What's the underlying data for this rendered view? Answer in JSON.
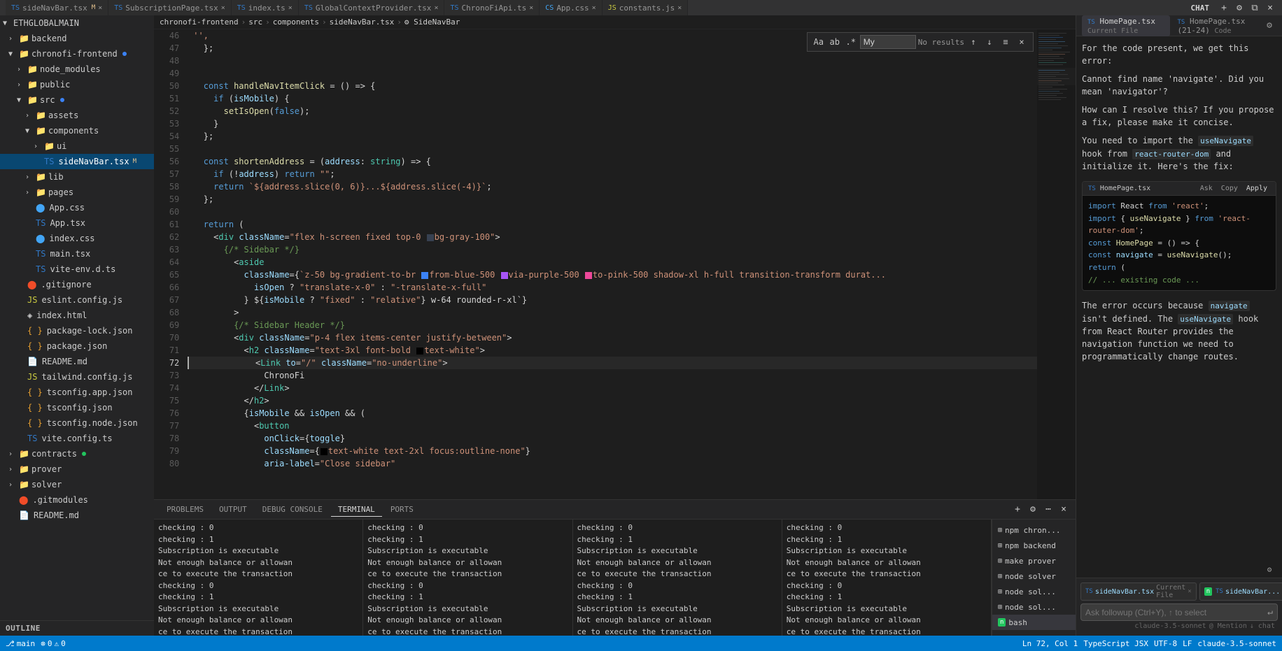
{
  "title": "ETHGLOBALMAIN",
  "tabs": [
    {
      "label": "sideNavBar.tsx",
      "type": "tsx",
      "active": false,
      "modified": true,
      "id": "sideNavBar-1"
    },
    {
      "label": "SubscriptionPage.tsx",
      "type": "tsx",
      "active": false,
      "modified": false,
      "id": "SubscriptionPage"
    },
    {
      "label": "index.ts",
      "type": "ts",
      "active": false,
      "modified": false,
      "id": "index-ts"
    },
    {
      "label": "GlobalContextProvider.tsx",
      "type": "tsx",
      "active": false,
      "modified": false,
      "id": "GlobalContext"
    },
    {
      "label": "ChronoFiApi.ts",
      "type": "ts",
      "active": false,
      "modified": false,
      "id": "ChronoFiApi"
    },
    {
      "label": "App.css",
      "type": "css",
      "active": false,
      "modified": false,
      "id": "App-css"
    },
    {
      "label": "constants.js",
      "type": "js",
      "active": false,
      "modified": false,
      "id": "constants"
    }
  ],
  "active_tab": "sideNavBar.tsx",
  "breadcrumb": [
    "chronofi-frontend",
    "src",
    "components",
    "sideNavBar.tsx",
    "SideNavBar"
  ],
  "find_widget": {
    "placeholder": "My",
    "no_results": "No results"
  },
  "sidebar": {
    "sections": [
      {
        "id": "explorer",
        "items": [
          {
            "label": "ETHGLOBALMAIN",
            "type": "section",
            "indent": 0
          },
          {
            "label": "backend",
            "type": "folder",
            "collapsed": true,
            "indent": 1
          },
          {
            "label": "chronofi-frontend",
            "type": "folder",
            "collapsed": false,
            "indent": 1,
            "dot": "blue"
          },
          {
            "label": "node_modules",
            "type": "folder",
            "collapsed": true,
            "indent": 2
          },
          {
            "label": "public",
            "type": "folder",
            "collapsed": true,
            "indent": 2
          },
          {
            "label": "src",
            "type": "folder",
            "collapsed": false,
            "indent": 2,
            "dot": "blue"
          },
          {
            "label": "assets",
            "type": "folder",
            "collapsed": true,
            "indent": 3
          },
          {
            "label": "components",
            "type": "folder",
            "collapsed": false,
            "indent": 3
          },
          {
            "label": "ui",
            "type": "folder",
            "collapsed": true,
            "indent": 4
          },
          {
            "label": "sideNavBar.tsx",
            "type": "tsx",
            "active": true,
            "indent": 4,
            "modified": true
          },
          {
            "label": "lib",
            "type": "folder",
            "collapsed": true,
            "indent": 3
          },
          {
            "label": "pages",
            "type": "folder",
            "collapsed": true,
            "indent": 3
          },
          {
            "label": "App.css",
            "type": "css",
            "indent": 3
          },
          {
            "label": "App.tsx",
            "type": "tsx",
            "indent": 3
          },
          {
            "label": "index.css",
            "type": "css",
            "indent": 3
          },
          {
            "label": "main.tsx",
            "type": "tsx",
            "indent": 3
          },
          {
            "label": "vite-env.d.ts",
            "type": "ts",
            "indent": 3
          },
          {
            "label": ".gitignore",
            "type": "git",
            "indent": 2
          },
          {
            "label": "eslint.config.js",
            "type": "js",
            "indent": 2
          },
          {
            "label": "index.html",
            "type": "html",
            "indent": 2
          },
          {
            "label": "package-lock.json",
            "type": "json",
            "indent": 2
          },
          {
            "label": "package.json",
            "type": "json",
            "indent": 2
          },
          {
            "label": "README.md",
            "type": "md",
            "indent": 2
          },
          {
            "label": "tailwind.config.js",
            "type": "js",
            "indent": 2
          },
          {
            "label": "tsconfig.app.json",
            "type": "json",
            "indent": 2
          },
          {
            "label": "tsconfig.json",
            "type": "json",
            "indent": 2
          },
          {
            "label": "tsconfig.node.json",
            "type": "json",
            "indent": 2
          },
          {
            "label": "vite.config.ts",
            "type": "ts",
            "indent": 2
          },
          {
            "label": "contracts",
            "type": "folder",
            "collapsed": true,
            "indent": 1,
            "dot": "green"
          },
          {
            "label": "prover",
            "type": "folder",
            "collapsed": true,
            "indent": 1
          },
          {
            "label": "solver",
            "type": "folder",
            "collapsed": true,
            "indent": 1
          },
          {
            "label": ".gitmodules",
            "type": "git",
            "indent": 1
          },
          {
            "label": "README.md",
            "type": "md",
            "indent": 1
          }
        ]
      }
    ],
    "outline_label": "OUTLINE"
  },
  "code": {
    "lines": [
      {
        "n": 46,
        "content": "    '',"
      },
      {
        "n": 47,
        "content": "  };"
      },
      {
        "n": 48,
        "content": ""
      },
      {
        "n": 49,
        "content": ""
      },
      {
        "n": 50,
        "content": "  const handleNavItemClick = () => {",
        "tokens": [
          {
            "t": "  "
          },
          {
            "t": "const",
            "c": "kw"
          },
          {
            "t": " "
          },
          {
            "t": "handleNavItemClick",
            "c": "fn"
          },
          {
            "t": " = () => {"
          }
        ]
      },
      {
        "n": 51,
        "content": "    if (isMobile) {",
        "tokens": [
          {
            "t": "    "
          },
          {
            "t": "if",
            "c": "kw"
          },
          {
            "t": " ("
          },
          {
            "t": "isMobile",
            "c": "var"
          },
          {
            "t": ") {"
          }
        ]
      },
      {
        "n": 52,
        "content": "      setIsOpen(false);",
        "tokens": [
          {
            "t": "      "
          },
          {
            "t": "setIsOpen",
            "c": "fn"
          },
          {
            "t": "("
          },
          {
            "t": "false",
            "c": "kw"
          },
          {
            "t": ");"
          }
        ]
      },
      {
        "n": 53,
        "content": "    }"
      },
      {
        "n": 54,
        "content": "  };"
      },
      {
        "n": 55,
        "content": ""
      },
      {
        "n": 56,
        "content": "  const shortenAddress = (address: string) => {",
        "tokens": [
          {
            "t": "  "
          },
          {
            "t": "const",
            "c": "kw"
          },
          {
            "t": " "
          },
          {
            "t": "shortenAddress",
            "c": "fn"
          },
          {
            "t": " = ("
          },
          {
            "t": "address",
            "c": "var"
          },
          {
            "t": ": "
          },
          {
            "t": "string",
            "c": "type"
          },
          {
            "t": ") => {"
          }
        ]
      },
      {
        "n": 57,
        "content": "    if (!address) return \"\";",
        "tokens": [
          {
            "t": "    "
          },
          {
            "t": "if",
            "c": "kw"
          },
          {
            "t": " (!"
          },
          {
            "t": "address",
            "c": "var"
          },
          {
            "t": ") "
          },
          {
            "t": "return",
            "c": "kw"
          },
          {
            "t": " "
          },
          {
            "t": "\"\"",
            "c": "str"
          },
          {
            "t": ";"
          }
        ]
      },
      {
        "n": 58,
        "content": "    return `${address.slice(0, 6)}...${address.slice(-4)}`;",
        "tokens": [
          {
            "t": "    "
          },
          {
            "t": "return",
            "c": "kw"
          },
          {
            "t": " "
          },
          {
            "t": "`${address.slice(0, 6)}...${address.slice(-4)}`",
            "c": "tmpl"
          },
          {
            "t": ";"
          }
        ]
      },
      {
        "n": 59,
        "content": "  };"
      },
      {
        "n": 60,
        "content": ""
      },
      {
        "n": 61,
        "content": "  return ("
      },
      {
        "n": 62,
        "content": "    <div className=\"flex h-screen fixed top-0 ■bg-gray-100\">"
      },
      {
        "n": 63,
        "content": "      {/* Sidebar */}"
      },
      {
        "n": 64,
        "content": "        <aside"
      },
      {
        "n": 65,
        "content": "          className={`z-50 bg-gradient-to-br ■from-blue-500 ■via-purple-500 ■to-pink-500 shadow-xl h-full transition-transform durat..."
      },
      {
        "n": 66,
        "content": "            isOpen ? \"translate-x-0\" : \"-translate-x-full\""
      },
      {
        "n": 67,
        "content": "          } ${isMobile ? \"fixed\" : \"relative\"} w-64 rounded-r-xl`}"
      },
      {
        "n": 68,
        "content": "        >"
      },
      {
        "n": 69,
        "content": "        {/* Sidebar Header */}"
      },
      {
        "n": 70,
        "content": "        <div className=\"p-4 flex items-center justify-between\">"
      },
      {
        "n": 71,
        "content": "          <h2 className=\"text-3xl font-bold ■text-white\">"
      },
      {
        "n": 72,
        "content": "            <Link to=\"/\" className=\"no-underline\">"
      },
      {
        "n": 73,
        "content": "              ChronoFi"
      },
      {
        "n": 74,
        "content": "            </Link>"
      },
      {
        "n": 75,
        "content": "          </h2>"
      },
      {
        "n": 76,
        "content": "          {isMobile && isOpen && ("
      },
      {
        "n": 77,
        "content": "            <button"
      },
      {
        "n": 78,
        "content": "              onClick={toggle}"
      },
      {
        "n": 79,
        "content": "              className={■text-white text-2xl focus:outline-none\"}"
      },
      {
        "n": 80,
        "content": "              aria-label=\"Close sidebar\""
      }
    ]
  },
  "chat": {
    "title": "CHAT",
    "tabs": [
      {
        "label": "HomePage.tsx",
        "sublabel": "Current File"
      },
      {
        "label": "HomePage.tsx (21-24)",
        "sublabel": "Code"
      }
    ],
    "messages": [
      {
        "type": "user",
        "text": "For the code present, we get this error:"
      },
      {
        "type": "user",
        "text": "Cannot find name 'navigate'. Did you mean 'navigator'?"
      },
      {
        "type": "user",
        "text": "How can I resolve this? If you propose a fix, please make it concise."
      },
      {
        "type": "assistant",
        "text_before": "You need to import the ",
        "code_inline": "useNavigate",
        "text_after": " hook from ",
        "code_inline2": "react-router-dom",
        "text_rest": " and initialize it. Here's the fix:"
      },
      {
        "type": "code_block",
        "file": "HomePage.tsx",
        "actions": [
          "Ask",
          "Copy",
          "Apply"
        ],
        "lines": [
          {
            "t": "import",
            "c": "kw",
            "rest": " React ",
            "r2": "from",
            "r2c": "kw",
            "r3": " ",
            "r4": "'react'",
            "r4c": "str",
            "r5": ";"
          },
          {
            "t": "import",
            "c": "kw",
            "rest": " { ",
            "r2": "useNavigate",
            "r2c": "fn",
            "r3": " } ",
            "r4": "from",
            "r4c": "kw",
            "r5": " ",
            "r6": "'react-router-dom'",
            "r6c": "str",
            "r7": ";"
          },
          {
            "t": ""
          },
          {
            "t": "const",
            "c": "kw",
            "rest": " ",
            "r2": "HomePage",
            "r2c": "fn",
            "r3": " = () => {"
          },
          {
            "t": "  const",
            "c": "kw",
            "rest": " ",
            "r2": "navigate",
            "r2c": "var",
            "r3": " = ",
            "r4": "useNavigate",
            "r4c": "fn",
            "r5": "();"
          },
          {
            "t": ""
          },
          {
            "t": "  return",
            "c": "kw",
            "rest": " ("
          },
          {
            "t": "    ",
            "rest": "// ... existing code ..."
          }
        ]
      },
      {
        "type": "assistant",
        "paragraph1_before": "The error occurs because ",
        "code1": "navigate",
        "paragraph1_mid": " isn't defined. The ",
        "code2": "useNavigate",
        "paragraph1_after": " hook from React Router provides the navigation function we need to programmatically change routes."
      }
    ],
    "input": {
      "placeholder": "Ask followup (Ctrl+Y), ↑ to select",
      "file_chip_label": "sideNavBar.tsx",
      "file_chip_sublabel": "Current File",
      "at_hint": "@",
      "mention_hint": "Mention"
    },
    "model_badge": "claude-3.5-sonnet",
    "send_actions": [
      "@ Mention",
      "↓ chat"
    ]
  },
  "terminal": {
    "tabs": [
      "PROBLEMS",
      "OUTPUT",
      "DEBUG CONSOLE",
      "TERMINAL",
      "PORTS"
    ],
    "active_tab": "TERMINAL",
    "panes": [
      {
        "lines": [
          "checking : 0",
          "checking : 1",
          "Subscription is executable",
          "Not enough balance or allowan",
          "ce to execute the transaction",
          "checking : 0",
          "checking : 1",
          "Subscription is executable",
          "Not enough balance or allowan",
          "ce to execute the transaction"
        ]
      },
      {
        "lines": [
          "checking : 0",
          "checking : 1",
          "Subscription is executable",
          "Not enough balance or allowan",
          "ce to execute the transaction",
          "checking : 0",
          "checking : 1",
          "Subscription is executable",
          "Not enough balance or allowan",
          "ce to execute the transaction"
        ]
      },
      {
        "lines": [
          "checking : 0",
          "checking : 1",
          "Subscription is executable",
          "Not enough balance or allowan",
          "ce to execute the transaction",
          "checking : 0",
          "checking : 1",
          "Subscription is executable",
          "Not enough balance or allowan",
          "ce to execute the transaction"
        ]
      },
      {
        "lines": [
          "checking : 0",
          "checking : 1",
          "Subscription is executable",
          "Not enough balance or allowan",
          "ce to execute the transaction",
          "checking : 0",
          "checking : 1",
          "Subscription is executable",
          "Not enough balance or allowan",
          "ce to execute the transaction"
        ]
      }
    ],
    "sidebar_items": [
      {
        "label": "npm chron...",
        "type": "ts"
      },
      {
        "label": "npm backend",
        "type": "ts"
      },
      {
        "label": "make prover",
        "type": "ts"
      },
      {
        "label": "node solver",
        "type": "ts"
      },
      {
        "label": "node sol...",
        "type": "ts"
      },
      {
        "label": "node sol...",
        "type": "ts"
      },
      {
        "label": "bash",
        "type": "ts",
        "active": true
      }
    ]
  },
  "status_bar": {
    "branch": "main",
    "errors": "0",
    "warnings": "0",
    "file_type": "TypeScript JSX",
    "encoding": "UTF-8",
    "line_ending": "LF",
    "line_col": "Ln 72, Col 1",
    "model": "claude-3.5-sonnet"
  }
}
